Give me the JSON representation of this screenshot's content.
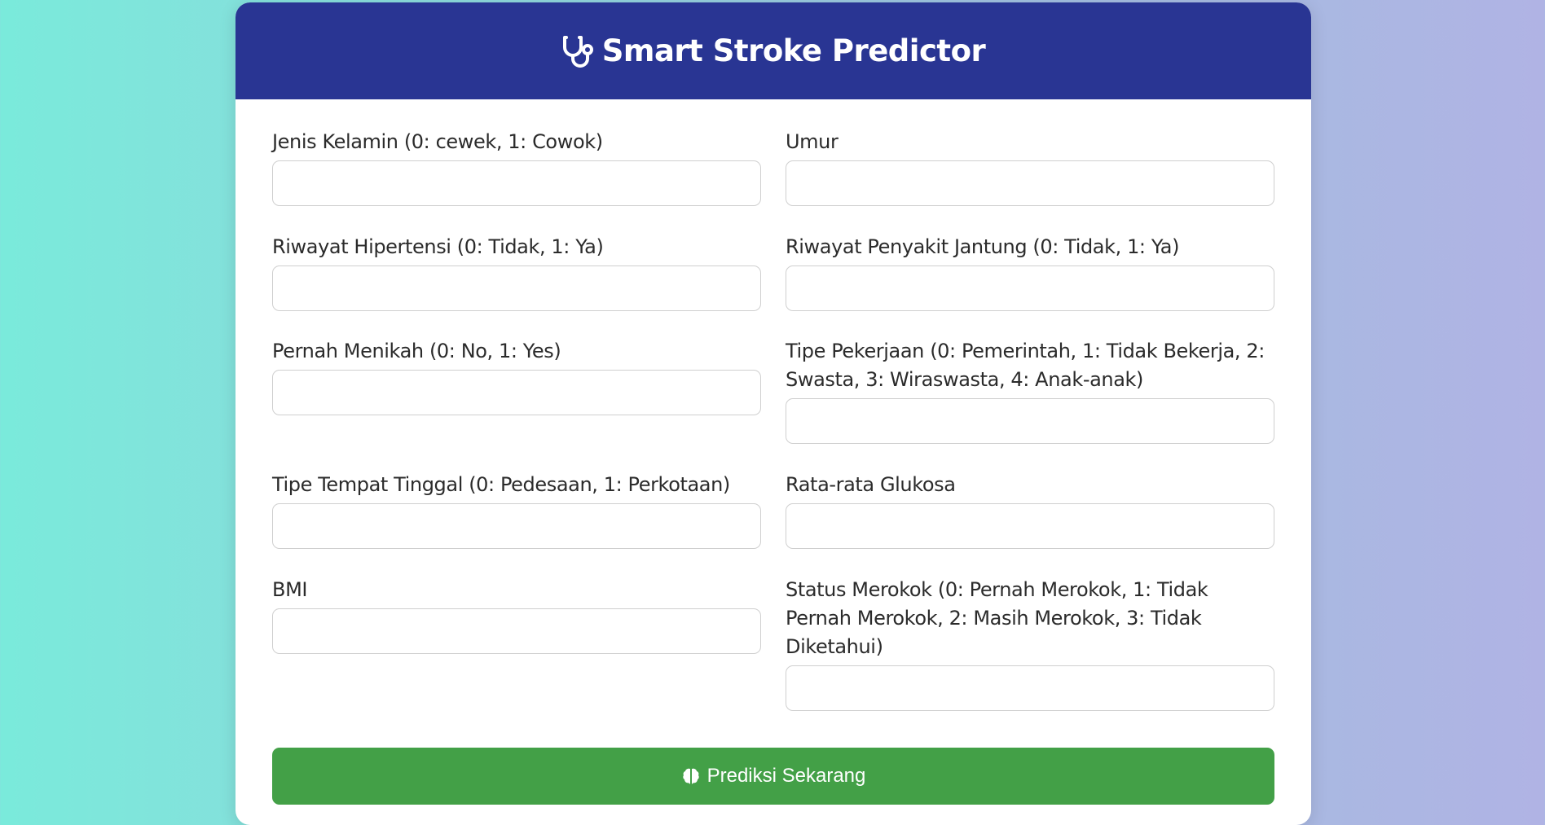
{
  "header": {
    "title": "Smart Stroke Predictor",
    "icon": "stethoscope-icon"
  },
  "fields": {
    "gender": {
      "label": "Jenis Kelamin (0: cewek, 1: Cowok)",
      "value": ""
    },
    "age": {
      "label": "Umur",
      "value": ""
    },
    "hypertension": {
      "label": "Riwayat Hipertensi (0: Tidak, 1: Ya)",
      "value": ""
    },
    "heart_disease": {
      "label": "Riwayat Penyakit Jantung (0: Tidak, 1: Ya)",
      "value": ""
    },
    "ever_married": {
      "label": "Pernah Menikah (0: No, 1: Yes)",
      "value": ""
    },
    "work_type": {
      "label": "Tipe Pekerjaan (0: Pemerintah, 1: Tidak Bekerja, 2: Swasta, 3: Wiraswasta, 4: Anak-anak)",
      "value": ""
    },
    "residence_type": {
      "label": "Tipe Tempat Tinggal (0: Pedesaan, 1: Perkotaan)",
      "value": ""
    },
    "avg_glucose": {
      "label": "Rata-rata Glukosa",
      "value": ""
    },
    "bmi": {
      "label": "BMI",
      "value": ""
    },
    "smoking_status": {
      "label": "Status Merokok (0: Pernah Merokok, 1: Tidak Pernah Merokok, 2: Masih Merokok, 3: Tidak Diketahui)",
      "value": ""
    }
  },
  "submit": {
    "label": "Prediksi Sekarang",
    "icon": "brain-icon"
  },
  "colors": {
    "header_bg": "#293593",
    "button_bg": "#43a047",
    "gradient_start": "#7aeadb",
    "gradient_end": "#b0b3e4"
  }
}
